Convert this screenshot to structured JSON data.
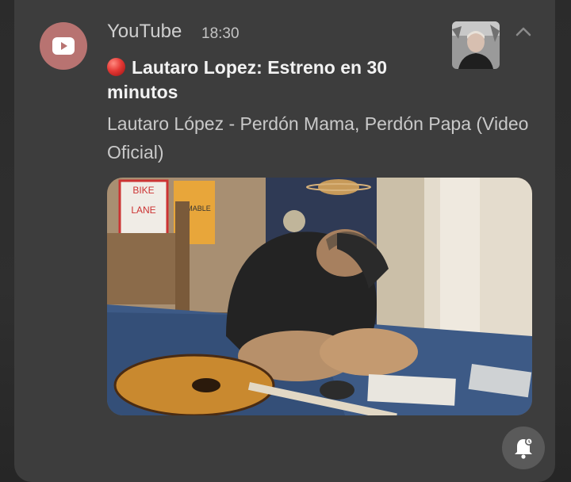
{
  "notification": {
    "app_name": "YouTube",
    "time": "18:30",
    "title": "Lautaro Lopez: Estreno en 30 minutos",
    "body": "Lautaro López - Perdón Mama, Perdón Papa (Video Oficial)"
  },
  "preview_image": {
    "signs": [
      "BIKE",
      "LANE",
      "LAMABLE"
    ]
  },
  "icons": {
    "app": "youtube-play-icon",
    "collapse": "chevron-up-icon",
    "live_dot": "red-circle-icon",
    "reminder": "bell-icon"
  },
  "colors": {
    "card": "#3d3d3d",
    "app_icon_bg": "#b87371",
    "live_dot": "#e53935"
  }
}
